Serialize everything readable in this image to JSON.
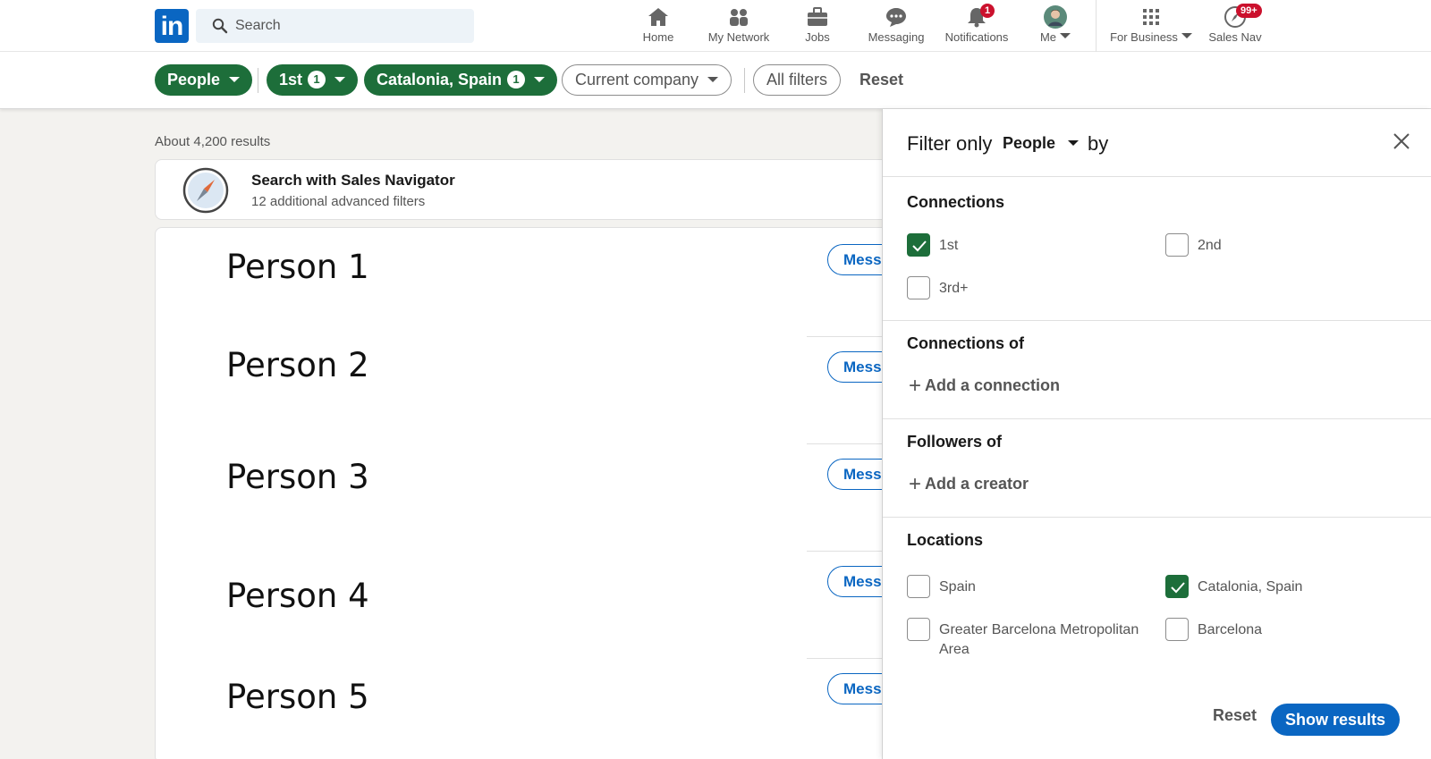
{
  "nav": {
    "search_placeholder": "Search",
    "items": [
      {
        "label": "Home",
        "icon": "home-icon"
      },
      {
        "label": "My Network",
        "icon": "network-icon"
      },
      {
        "label": "Jobs",
        "icon": "briefcase-icon"
      },
      {
        "label": "Messaging",
        "icon": "messaging-icon"
      },
      {
        "label": "Notifications",
        "icon": "bell-icon",
        "badge": "1"
      },
      {
        "label": "Me",
        "icon": "avatar"
      },
      {
        "label": "For Business",
        "icon": "grid-icon"
      },
      {
        "label": "Sales Nav",
        "icon": "compass-icon",
        "badge": "99+"
      }
    ],
    "logo_text": "in"
  },
  "filterbar": {
    "people": "People",
    "first": "1st",
    "first_count": "1",
    "location": "Catalonia, Spain",
    "location_count": "1",
    "current_company": "Current company",
    "all_filters": "All filters",
    "reset": "Reset"
  },
  "results": {
    "count_text": "About 4,200 results",
    "salesnav_title": "Search with Sales Navigator",
    "salesnav_sub": "12 additional advanced filters",
    "people": [
      "Person 1",
      "Person 2",
      "Person 3",
      "Person 4",
      "Person 5"
    ],
    "message_label": "Mess"
  },
  "panel": {
    "filter_only": "Filter only",
    "type": "People",
    "by": "by",
    "connections_title": "Connections",
    "connections": [
      {
        "label": "1st",
        "checked": true
      },
      {
        "label": "2nd",
        "checked": false
      },
      {
        "label": "3rd+",
        "checked": false
      }
    ],
    "connections_of_title": "Connections of",
    "add_connection": "Add a connection",
    "followers_of_title": "Followers of",
    "add_creator": "Add a creator",
    "locations_title": "Locations",
    "locations": [
      {
        "label": "Spain",
        "checked": false
      },
      {
        "label": "Catalonia, Spain",
        "checked": true
      },
      {
        "label": "Greater Barcelona Metropolitan Area",
        "checked": false
      },
      {
        "label": "Barcelona",
        "checked": false
      }
    ],
    "reset": "Reset",
    "show_results": "Show results"
  },
  "colors": {
    "linkedin_blue": "#0a66c2",
    "filter_green": "#1d6e3a",
    "badge_red": "#cb112d"
  }
}
